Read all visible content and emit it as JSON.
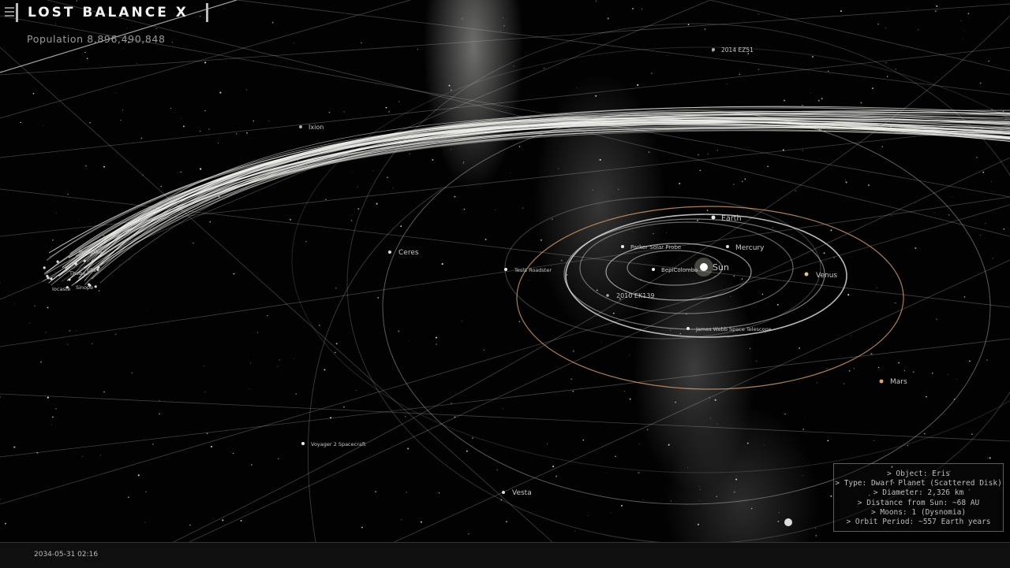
{
  "app": {
    "title": "LOST BALANCE X"
  },
  "population": {
    "text": "Population 8,896,490,848"
  },
  "objects": {
    "sun": "Sun",
    "earth": "Earth",
    "mercury": "Mercury",
    "venus": "Venus",
    "mars": "Mars",
    "ceres": "Ceres",
    "vesta": "Vesta",
    "ixion": "Ixion",
    "ez51": "2014 EZ51",
    "ek139": "2010 EK139",
    "parker": "Parker Solar Probe",
    "bepi": "BepiColombo",
    "tesla": "Tesla Roadster",
    "jwst": "James Webb Space Telescope",
    "voyager": "Voyager 2 Spacecraft",
    "praxidike": "Praxidike",
    "thebe": "Thebe",
    "ella": "Ella",
    "iocaste": "Iocaste",
    "sinope": "Sinope"
  },
  "info_panel": {
    "lines": [
      "> Object: Eris",
      "> Type: Dwarf Planet (Scattered Disk)",
      "> Diameter: 2,326 km",
      "> Distance from Sun: ~68 AU",
      "> Moons: 1 (Dysnomia)",
      "> Orbit Period: ~557 Earth years"
    ]
  },
  "status": {
    "datetime": "2034-05-31 02:16"
  },
  "colors": {
    "orbit": "#c9c9c9",
    "mars_orbit": "#c8956a",
    "venus": "#d8c890",
    "title": "#f2f2f2"
  }
}
